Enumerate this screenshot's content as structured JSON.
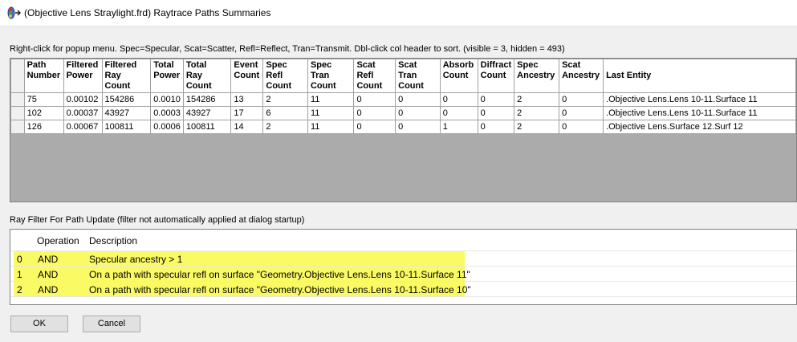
{
  "window": {
    "title": "(Objective Lens Straylight.frd) Raytrace Paths Summaries"
  },
  "hint": "Right-click for popup menu.  Spec=Specular, Scat=Scatter,  Refl=Reflect, Tran=Transmit.  Dbl-click col header to sort.    (visible = 3,  hidden = 493)",
  "paths_table": {
    "columns": [
      [
        "Path",
        "Number"
      ],
      [
        "Filtered",
        "Power"
      ],
      [
        "Filtered",
        "Ray Count"
      ],
      [
        "Total",
        "Power"
      ],
      [
        "Total",
        "Ray Count"
      ],
      [
        "Event",
        "Count"
      ],
      [
        "Spec Refl",
        "Count"
      ],
      [
        "Spec Tran",
        "Count"
      ],
      [
        "Scat Refl",
        "Count"
      ],
      [
        "Scat Tran",
        "Count"
      ],
      [
        "Absorb",
        "Count"
      ],
      [
        "Diffract",
        "Count"
      ],
      [
        "Spec",
        "Ancestry"
      ],
      [
        "Scat",
        "Ancestry"
      ],
      [
        "Last Entity",
        ""
      ]
    ],
    "rows": [
      [
        "75",
        "0.00102",
        "154286",
        "0.0010",
        "154286",
        "13",
        "2",
        "11",
        "0",
        "0",
        "0",
        "0",
        "2",
        "0",
        ".Objective Lens.Lens 10-11.Surface 11"
      ],
      [
        "102",
        "0.00037",
        "43927",
        "0.0003",
        "43927",
        "17",
        "6",
        "11",
        "0",
        "0",
        "0",
        "0",
        "2",
        "0",
        ".Objective Lens.Lens 10-11.Surface 11"
      ],
      [
        "126",
        "0.00067",
        "100811",
        "0.0006",
        "100811",
        "14",
        "2",
        "11",
        "0",
        "0",
        "1",
        "0",
        "2",
        "0",
        ".Objective Lens.Surface 12.Surf 12"
      ]
    ]
  },
  "filter": {
    "label": "Ray Filter For Path Update   (filter not automatically applied at dialog startup)",
    "headers": {
      "operation": "Operation",
      "description": "Description"
    },
    "rows": [
      {
        "index": "0",
        "operation": "AND",
        "description": "Specular ancestry  >  1"
      },
      {
        "index": "1",
        "operation": "AND",
        "description": "On a path with specular refl on surface \"Geometry.Objective Lens.Lens 10-11.Surface 11\""
      },
      {
        "index": "2",
        "operation": "AND",
        "description": "On a path with specular refl on surface \"Geometry.Objective Lens.Lens 10-11.Surface 10\""
      }
    ],
    "highlight_color": "#fafa64"
  },
  "buttons": {
    "ok": "OK",
    "cancel": "Cancel"
  }
}
